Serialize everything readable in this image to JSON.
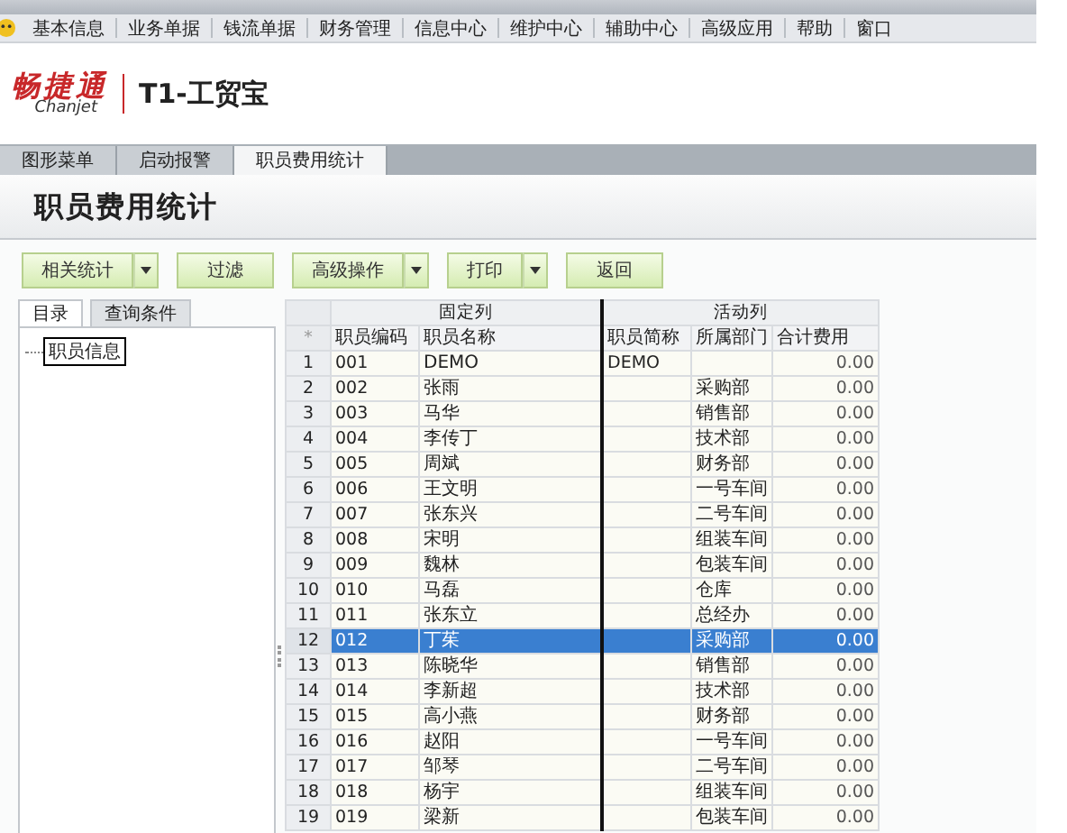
{
  "menu": [
    "基本信息",
    "业务单据",
    "钱流单据",
    "财务管理",
    "信息中心",
    "维护中心",
    "辅助中心",
    "高级应用",
    "帮助",
    "窗口"
  ],
  "logo": {
    "brand": "畅捷通",
    "brand_sub": "Chanjet",
    "product": "T1-工贸宝"
  },
  "tabs": [
    {
      "label": "图形菜单",
      "selected": false
    },
    {
      "label": "启动报警",
      "selected": false
    },
    {
      "label": "职员费用统计",
      "selected": true
    }
  ],
  "page_title": "职员费用统计",
  "toolbar": [
    {
      "label": "相关统计",
      "dropdown": true
    },
    {
      "label": "过滤",
      "dropdown": false
    },
    {
      "label": "高级操作",
      "dropdown": true
    },
    {
      "label": "打印",
      "dropdown": true
    },
    {
      "label": "返回",
      "dropdown": false
    }
  ],
  "side_tabs": [
    {
      "label": "目录",
      "selected": true
    },
    {
      "label": "查询条件",
      "selected": false
    }
  ],
  "tree": [
    {
      "label": "职员信息",
      "selected": true
    }
  ],
  "table": {
    "groups": [
      "固定列",
      "活动列"
    ],
    "corner": "*",
    "columns": [
      "职员编码",
      "职员名称",
      "职员简称",
      "所属部门",
      "合计费用"
    ],
    "rows": [
      {
        "num": "1",
        "cells": [
          "001",
          "DEMO",
          "DEMO",
          "",
          "0.00"
        ],
        "selected": false
      },
      {
        "num": "2",
        "cells": [
          "002",
          "张雨",
          "",
          "采购部",
          "0.00"
        ],
        "selected": false
      },
      {
        "num": "3",
        "cells": [
          "003",
          "马华",
          "",
          "销售部",
          "0.00"
        ],
        "selected": false
      },
      {
        "num": "4",
        "cells": [
          "004",
          "李传丁",
          "",
          "技术部",
          "0.00"
        ],
        "selected": false
      },
      {
        "num": "5",
        "cells": [
          "005",
          "周斌",
          "",
          "财务部",
          "0.00"
        ],
        "selected": false
      },
      {
        "num": "6",
        "cells": [
          "006",
          "王文明",
          "",
          "一号车间",
          "0.00"
        ],
        "selected": false
      },
      {
        "num": "7",
        "cells": [
          "007",
          "张东兴",
          "",
          "二号车间",
          "0.00"
        ],
        "selected": false
      },
      {
        "num": "8",
        "cells": [
          "008",
          "宋明",
          "",
          "组装车间",
          "0.00"
        ],
        "selected": false
      },
      {
        "num": "9",
        "cells": [
          "009",
          "魏林",
          "",
          "包装车间",
          "0.00"
        ],
        "selected": false
      },
      {
        "num": "10",
        "cells": [
          "010",
          "马磊",
          "",
          "仓库",
          "0.00"
        ],
        "selected": false
      },
      {
        "num": "11",
        "cells": [
          "011",
          "张东立",
          "",
          "总经办",
          "0.00"
        ],
        "selected": false
      },
      {
        "num": "12",
        "cells": [
          "012",
          "丁茱",
          "",
          "采购部",
          "0.00"
        ],
        "selected": true
      },
      {
        "num": "13",
        "cells": [
          "013",
          "陈晓华",
          "",
          "销售部",
          "0.00"
        ],
        "selected": false
      },
      {
        "num": "14",
        "cells": [
          "014",
          "李新超",
          "",
          "技术部",
          "0.00"
        ],
        "selected": false
      },
      {
        "num": "15",
        "cells": [
          "015",
          "高小燕",
          "",
          "财务部",
          "0.00"
        ],
        "selected": false
      },
      {
        "num": "16",
        "cells": [
          "016",
          "赵阳",
          "",
          "一号车间",
          "0.00"
        ],
        "selected": false
      },
      {
        "num": "17",
        "cells": [
          "017",
          "邹琴",
          "",
          "二号车间",
          "0.00"
        ],
        "selected": false
      },
      {
        "num": "18",
        "cells": [
          "018",
          "杨宇",
          "",
          "组装车间",
          "0.00"
        ],
        "selected": false
      },
      {
        "num": "19",
        "cells": [
          "019",
          "梁新",
          "",
          "包装车间",
          "0.00"
        ],
        "selected": false
      }
    ]
  }
}
